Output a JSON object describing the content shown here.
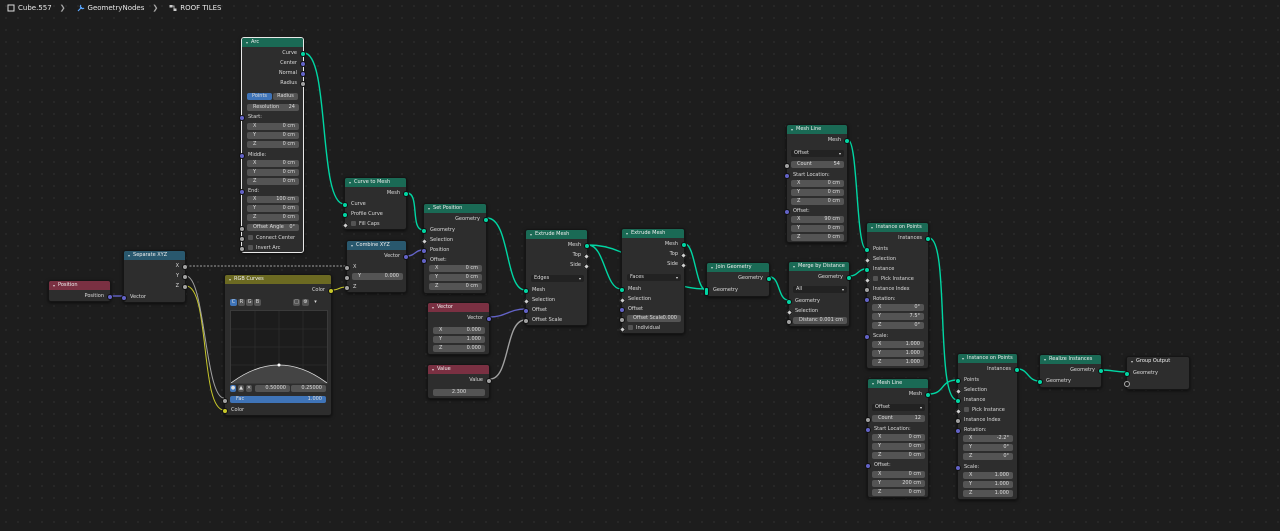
{
  "breadcrumb": {
    "object": "Cube.557",
    "modifier": "GeometryNodes",
    "group": "ROOF TILES"
  },
  "colors": {
    "geometry": "#00d6a3",
    "vector": "#6363c7",
    "float": "#a1a1a1",
    "color": "#c7c729",
    "header_geometry": "#1a6a55",
    "header_vector": "#29586e",
    "header_input": "#7a3042",
    "header_color": "#6c6a22"
  },
  "nodes": {
    "arc": {
      "title": "Arc",
      "outputs": [
        "Curve",
        "Center",
        "Normal",
        "Radius"
      ],
      "mode_a": "Points",
      "mode_b": "Radius",
      "resolution_label": "Resolution",
      "resolution": "24",
      "start_label": "Start:",
      "start": [
        {
          "k": "X",
          "v": "0 cm"
        },
        {
          "k": "Y",
          "v": "0 cm"
        },
        {
          "k": "Z",
          "v": "0 cm"
        }
      ],
      "middle_label": "Middle:",
      "middle": [
        {
          "k": "X",
          "v": "0 cm"
        },
        {
          "k": "Y",
          "v": "0 cm"
        },
        {
          "k": "Z",
          "v": "0 cm"
        }
      ],
      "end_label": "End:",
      "end": [
        {
          "k": "X",
          "v": "100 cm"
        },
        {
          "k": "Y",
          "v": "0 cm"
        },
        {
          "k": "Z",
          "v": "0 cm"
        }
      ],
      "offset_angle_label": "Offset Angle",
      "offset_angle": "0°",
      "connect_center": "Connect Center",
      "invert_arc": "Invert Arc"
    },
    "position": {
      "title": "Position",
      "out": "Position"
    },
    "separate": {
      "title": "Separate XYZ",
      "outputs": [
        "X",
        "Y",
        "Z"
      ],
      "input": "Vector"
    },
    "rgb": {
      "title": "RGB Curves",
      "out": "Color",
      "channels": [
        "C",
        "R",
        "G",
        "B"
      ],
      "x_val": "0.50000",
      "y_val": "0.25000",
      "fac_label": "Fac",
      "fac": "1.000",
      "color_in": "Color"
    },
    "curve_to_mesh": {
      "title": "Curve to Mesh",
      "out": "Mesh",
      "inputs": [
        "Curve",
        "Profile Curve"
      ],
      "fill_caps": "Fill Caps"
    },
    "combine": {
      "title": "Combine XYZ",
      "out": "Vector",
      "x": "X",
      "y_label": "Y",
      "y": "0.000",
      "z": "Z"
    },
    "set_position": {
      "title": "Set Position",
      "out": "Geometry",
      "inputs": [
        "Geometry",
        "Selection",
        "Position"
      ],
      "offset_label": "Offset:",
      "offset": [
        {
          "k": "X",
          "v": "0 cm"
        },
        {
          "k": "Y",
          "v": "0 cm"
        },
        {
          "k": "Z",
          "v": "0 cm"
        }
      ]
    },
    "vector": {
      "title": "Vector",
      "out": "Vector",
      "vals": [
        {
          "k": "X",
          "v": "0.000"
        },
        {
          "k": "Y",
          "v": "1.000"
        },
        {
          "k": "Z",
          "v": "0.000"
        }
      ]
    },
    "value": {
      "title": "Value",
      "out": "Value",
      "val": "2.300"
    },
    "extrude1": {
      "title": "Extrude Mesh",
      "outputs": [
        "Mesh",
        "Top",
        "Side"
      ],
      "mode": "Edges",
      "inputs": [
        "Mesh",
        "Selection",
        "Offset",
        "Offset Scale"
      ]
    },
    "extrude2": {
      "title": "Extrude Mesh",
      "outputs": [
        "Mesh",
        "Top",
        "Side"
      ],
      "mode": "Faces",
      "inputs": [
        "Mesh",
        "Selection",
        "Offset"
      ],
      "offset_scale_label": "Offset Scale",
      "offset_scale": "0.000",
      "individual": "Individual"
    },
    "join": {
      "title": "Join Geometry",
      "out": "Geometry",
      "in": "Geometry"
    },
    "mesh_line1": {
      "title": "Mesh Line",
      "out": "Mesh",
      "mode": "Offset",
      "count_label": "Count",
      "count": "54",
      "start_label": "Start Location:",
      "start": [
        {
          "k": "X",
          "v": "0 cm"
        },
        {
          "k": "Y",
          "v": "0 cm"
        },
        {
          "k": "Z",
          "v": "0 cm"
        }
      ],
      "offset_label": "Offset:",
      "offset": [
        {
          "k": "X",
          "v": "90 cm"
        },
        {
          "k": "Y",
          "v": "0 cm"
        },
        {
          "k": "Z",
          "v": "0 cm"
        }
      ]
    },
    "merge": {
      "title": "Merge by Distance",
      "out": "Geometry",
      "mode": "All",
      "inputs": [
        "Geometry",
        "Selection"
      ],
      "dist_label": "Distanc",
      "dist": "0.001 cm"
    },
    "iop1": {
      "title": "Instance on Points",
      "out": "Instances",
      "inputs": [
        "Points",
        "Selection",
        "Instance"
      ],
      "pick": "Pick Instance",
      "index": "Instance Index",
      "rot_label": "Rotation:",
      "rot": [
        {
          "k": "X",
          "v": "0°"
        },
        {
          "k": "Y",
          "v": "7.5°"
        },
        {
          "k": "Z",
          "v": "0°"
        }
      ],
      "scale_label": "Scale:",
      "scale": [
        {
          "k": "X",
          "v": "1.000"
        },
        {
          "k": "Y",
          "v": "1.000"
        },
        {
          "k": "Z",
          "v": "1.000"
        }
      ]
    },
    "mesh_line2": {
      "title": "Mesh Line",
      "out": "Mesh",
      "mode": "Offset",
      "count_label": "Count",
      "count": "12",
      "start_label": "Start Location:",
      "start": [
        {
          "k": "X",
          "v": "0 cm"
        },
        {
          "k": "Y",
          "v": "0 cm"
        },
        {
          "k": "Z",
          "v": "0 cm"
        }
      ],
      "offset_label": "Offset:",
      "offset": [
        {
          "k": "X",
          "v": "0 cm"
        },
        {
          "k": "Y",
          "v": "200 cm"
        },
        {
          "k": "Z",
          "v": "0 cm"
        }
      ]
    },
    "iop2": {
      "title": "Instance on Points",
      "out": "Instances",
      "inputs": [
        "Points",
        "Selection",
        "Instance"
      ],
      "pick": "Pick Instance",
      "index": "Instance Index",
      "rot_label": "Rotation:",
      "rot": [
        {
          "k": "X",
          "v": "-2.2°"
        },
        {
          "k": "Y",
          "v": "0°"
        },
        {
          "k": "Z",
          "v": "0°"
        }
      ],
      "scale_label": "Scale:",
      "scale": [
        {
          "k": "X",
          "v": "1.000"
        },
        {
          "k": "Y",
          "v": "1.000"
        },
        {
          "k": "Z",
          "v": "1.000"
        }
      ]
    },
    "realize": {
      "title": "Realize Instances",
      "out": "Geometry",
      "in": "Geometry"
    },
    "group_output": {
      "title": "Group Output",
      "in": "Geometry"
    }
  }
}
